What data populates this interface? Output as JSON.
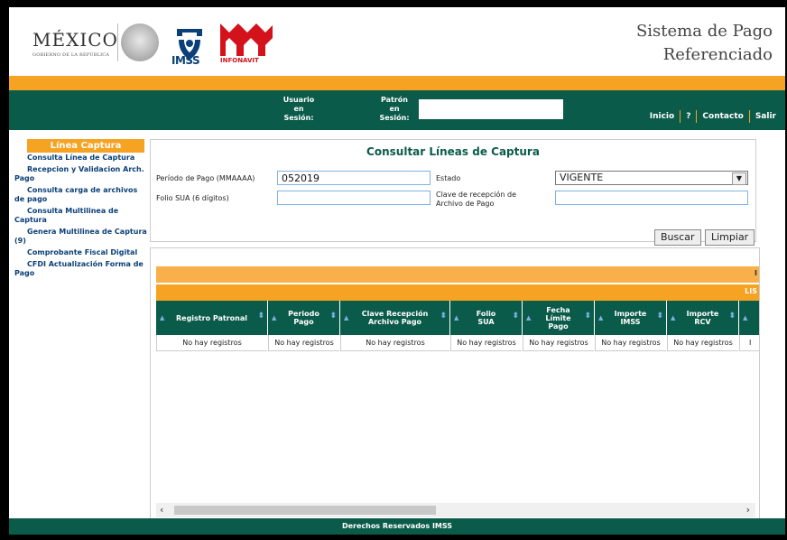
{
  "header": {
    "country": "MÉXICO",
    "government": "GOBIERNO DE LA REPÚBLICA",
    "imss": "IMSS",
    "infonavit": "INFONAVIT",
    "app_title_line1": "Sistema de Pago",
    "app_title_line2": "Referenciado"
  },
  "session": {
    "usuario_label_1": "Usuario",
    "usuario_label_2": "en",
    "usuario_label_3": "Sesión:",
    "patron_label_1": "Patrón",
    "patron_label_2": "en",
    "patron_label_3": "Sesión:"
  },
  "nav": {
    "inicio": "Inicio",
    "help": "?",
    "contacto": "Contacto",
    "salir": "Salir"
  },
  "sidebar": {
    "header": "Línea Captura",
    "items": [
      {
        "label": "Consulta Línea de Captura"
      },
      {
        "label": "Recepcion y Validacion Arch. Pago"
      },
      {
        "label": "Consulta carga de archivos de pago"
      },
      {
        "label": "Consulta Multilinea de Captura"
      },
      {
        "label": "Genera Multilinea de Captura (9)"
      },
      {
        "label": "Comprobante Fiscal Digital"
      },
      {
        "label": "CFDI Actualización Forma de Pago"
      }
    ]
  },
  "form": {
    "title": "Consultar Líneas de Captura",
    "periodo_label": "Período de Pago (MMAAAA)",
    "periodo_value": "052019",
    "estado_label": "Estado",
    "estado_value": "VIGENTE",
    "folio_label": "Folio SUA (6 dígitos)",
    "folio_value": "",
    "clave_label_1": "Clave de recepción de",
    "clave_label_2": "Archivo de Pago",
    "clave_value": "",
    "buscar": "Buscar",
    "limpiar": "Limpiar"
  },
  "results": {
    "band1_text": "I",
    "band2_text": "LIS",
    "columns": [
      {
        "label": "Registro Patronal",
        "cell": "No hay registros"
      },
      {
        "label": "Periodo Pago",
        "cell": "No hay registros"
      },
      {
        "label": "Clave Recepción Archivo Pago",
        "cell": "No hay registros"
      },
      {
        "label": "Folio SUA",
        "cell": "No hay registros"
      },
      {
        "label": "Fecha Límite Pago",
        "cell": "No hay registros"
      },
      {
        "label": "Importe IMSS",
        "cell": "No hay registros"
      },
      {
        "label": "Importe RCV",
        "cell": "No hay registros"
      },
      {
        "label": "",
        "cell": "I"
      }
    ]
  },
  "footer": {
    "text": "Derechos Reservados IMSS"
  },
  "colors": {
    "green": "#0b5b4a",
    "orange": "#f6a222",
    "link_blue": "#0a3f78"
  }
}
